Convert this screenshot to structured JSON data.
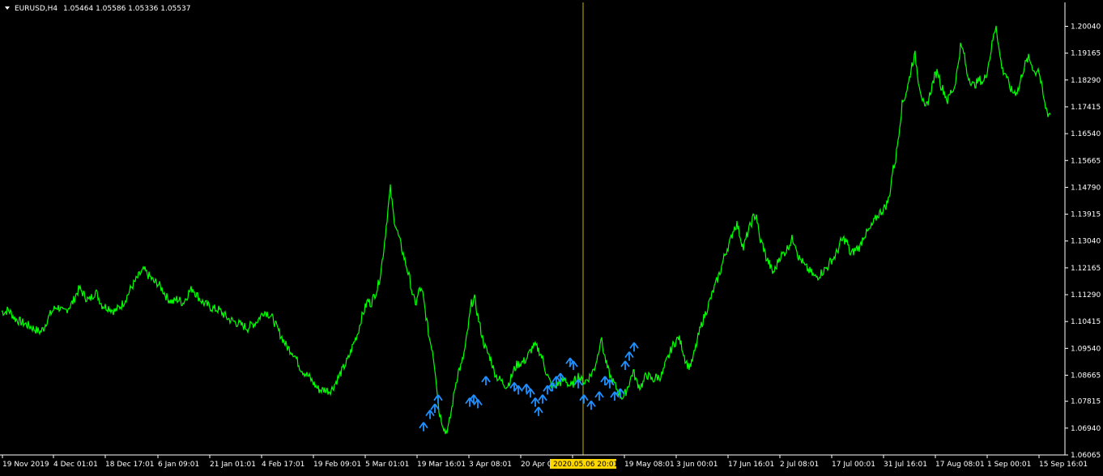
{
  "header": {
    "symbol_timeframe": "EURUSD,H4",
    "ohlc": "1.05464 1.05586 1.05336 1.05537"
  },
  "cursor": {
    "time_label": "2020.05.06 20:01"
  },
  "colors": {
    "background": "#000000",
    "price_line": "#00ff00",
    "arrows": "#1e90ff",
    "axis": "#ffffff",
    "crosshair": "#c8b400",
    "time_highlight": "#ffd700"
  },
  "chart_data": {
    "type": "line",
    "title": "EURUSD,H4",
    "ylim": [
      1.059,
      1.206
    ],
    "y_ticks": [
      "1.20040",
      "1.19165",
      "1.18290",
      "1.17415",
      "1.16540",
      "1.15665",
      "1.14790",
      "1.13915",
      "1.13040",
      "1.12165",
      "1.11290",
      "1.10415",
      "1.09540",
      "1.08665",
      "1.07815",
      "1.06940",
      "1.06065"
    ],
    "x_ticks": [
      "19 Nov 2019",
      "4 Dec 01:01",
      "18 Dec 17:01",
      "6 Jan 09:01",
      "21 Jan 01:01",
      "4 Feb 17:01",
      "19 Feb 09:01",
      "5 Mar 01:01",
      "19 Mar 16:01",
      "3 Apr 08:01",
      "20 Apr 00:01",
      "",
      "19 May 08:01",
      "3 Jun 00:01",
      "17 Jun 16:01",
      "2 Jul 08:01",
      "17 Jul 00:01",
      "31 Jul 16:01",
      "17 Aug 08:01",
      "1 Sep 00:01",
      "15 Sep 16:01"
    ],
    "series": [
      {
        "x_index": [
          0,
          4,
          8,
          12,
          16,
          20,
          24,
          28,
          32,
          36,
          40,
          44,
          48,
          52,
          56,
          60,
          64,
          68,
          72,
          76,
          80,
          84,
          88,
          92,
          96,
          100,
          104,
          108,
          112,
          116,
          120,
          124,
          128,
          132,
          136,
          140,
          144,
          148,
          152,
          156,
          160,
          164,
          168,
          172,
          176,
          180,
          184,
          188,
          192,
          196,
          200,
          204,
          208,
          212,
          216,
          220,
          224,
          228,
          232,
          236,
          240,
          244,
          248,
          252,
          256,
          260,
          264,
          268,
          272,
          276,
          280,
          284,
          288,
          292,
          296,
          300,
          304,
          308,
          312,
          316,
          320,
          324,
          328,
          332,
          336,
          340,
          344,
          348,
          352,
          356,
          360,
          364,
          368,
          372,
          376,
          380,
          384,
          388,
          392,
          396,
          400,
          404,
          408,
          412,
          416,
          420,
          424,
          428,
          432,
          436,
          440,
          444,
          448,
          452,
          456,
          460,
          464,
          468,
          472,
          476,
          480,
          484,
          488,
          492,
          496,
          500,
          504,
          508,
          512,
          516,
          520,
          524,
          528,
          532,
          536,
          540,
          544,
          548,
          552,
          556,
          560,
          564,
          568,
          572,
          576,
          580,
          584,
          588,
          592,
          596,
          600,
          604,
          608,
          612,
          616,
          620,
          624,
          628,
          632,
          636,
          640,
          644,
          648,
          652,
          656,
          660,
          664,
          668,
          672,
          676,
          680,
          684,
          688,
          692,
          696,
          700,
          704,
          708,
          712,
          716,
          720,
          724,
          728,
          732,
          736,
          740,
          744,
          748,
          752,
          756,
          760,
          764,
          768,
          772,
          776,
          780,
          784,
          788,
          792,
          796,
          800,
          804,
          808,
          812,
          816,
          820,
          824,
          828,
          832,
          836,
          840,
          844,
          848,
          852,
          856,
          860,
          864,
          868,
          872,
          876,
          880,
          884,
          888,
          892,
          896,
          900,
          904,
          908,
          912,
          916,
          920,
          924,
          928,
          932,
          936,
          940,
          944,
          948,
          952,
          956,
          960,
          964,
          968,
          972,
          976,
          980,
          984,
          988,
          992,
          996,
          1000,
          1004,
          1008,
          1012,
          1016,
          1020,
          1024,
          1028,
          1032,
          1036,
          1040,
          1044,
          1048,
          1052,
          1056,
          1060,
          1064,
          1068,
          1072,
          1076,
          1080,
          1084,
          1088,
          1092,
          1096,
          1100,
          1104,
          1108,
          1112,
          1116,
          1120,
          1124,
          1128,
          1132,
          1136,
          1140,
          1144,
          1148,
          1152,
          1156,
          1160,
          1164,
          1168,
          1172,
          1176,
          1180,
          1184,
          1188,
          1192,
          1196,
          1200,
          1204,
          1208,
          1212,
          1216,
          1220,
          1224,
          1228,
          1232,
          1236,
          1240,
          1244,
          1248,
          1252,
          1256,
          1260,
          1264,
          1268,
          1272,
          1276,
          1280,
          1284,
          1288,
          1292,
          1296,
          1300,
          1304,
          1308,
          1312
        ],
        "values": [
          1.1075,
          1.1072,
          1.108,
          1.1068,
          1.1052,
          1.1045,
          1.104,
          1.1035,
          1.103,
          1.1025,
          1.1018,
          1.1012,
          1.1008,
          1.102,
          1.1045,
          1.1065,
          1.108,
          1.109,
          1.1085,
          1.107,
          1.108,
          1.1092,
          1.1105,
          1.113,
          1.115,
          1.1135,
          1.112,
          1.111,
          1.1125,
          1.114,
          1.1118,
          1.1095,
          1.109,
          1.1088,
          1.108,
          1.1075,
          1.1085,
          1.1095,
          1.111,
          1.113,
          1.1152,
          1.1168,
          1.1185,
          1.12,
          1.121,
          1.1195,
          1.1185,
          1.117,
          1.1168,
          1.1155,
          1.114,
          1.112,
          1.111,
          1.1105,
          1.1115,
          1.111,
          1.1102,
          1.112,
          1.114,
          1.115,
          1.1132,
          1.1118,
          1.1105,
          1.1098,
          1.1092,
          1.1085,
          1.1082,
          1.108,
          1.107,
          1.106,
          1.105,
          1.1045,
          1.104,
          1.1035,
          1.103,
          1.1025,
          1.102,
          1.103,
          1.1035,
          1.1045,
          1.106,
          1.1075,
          1.107,
          1.106,
          1.1045,
          1.102,
          1.1,
          1.098,
          1.096,
          1.095,
          1.094,
          1.092,
          1.0895,
          1.088,
          1.087,
          1.086,
          1.0845,
          1.083,
          1.082,
          1.0818,
          1.082,
          1.0815,
          1.0822,
          1.084,
          1.086,
          1.088,
          1.09,
          1.092,
          1.095,
          1.098,
          1.1005,
          1.105,
          1.108,
          1.111,
          1.11,
          1.1125,
          1.115,
          1.12,
          1.128,
          1.138,
          1.1475,
          1.1385,
          1.134,
          1.13,
          1.126,
          1.122,
          1.118,
          1.112,
          1.11,
          1.115,
          1.113,
          1.106,
          1.099,
          1.095,
          1.087,
          1.075,
          1.0715,
          1.068,
          1.07,
          1.076,
          1.083,
          1.088,
          1.09,
          1.095,
          1.102,
          1.11,
          1.1115,
          1.106,
          1.101,
          1.0965,
          1.094,
          1.092,
          1.088,
          1.086,
          1.085,
          1.084,
          1.083,
          1.085,
          1.088,
          1.09,
          1.0905,
          1.091,
          1.092,
          1.094,
          1.096,
          1.096,
          1.0945,
          1.092,
          1.088,
          1.085,
          1.083,
          1.083,
          1.084,
          1.0845,
          1.0855,
          1.0835,
          1.083,
          1.085,
          1.0865,
          1.085,
          1.0845,
          1.0855,
          1.087,
          1.089,
          1.093,
          1.099,
          1.0935,
          1.089,
          1.086,
          1.084,
          1.082,
          1.08,
          1.0795,
          1.082,
          1.085,
          1.088,
          1.0845,
          1.083,
          1.084,
          1.087,
          1.086,
          1.085,
          1.086,
          1.086,
          1.087,
          1.0905,
          1.093,
          1.096,
          1.0975,
          1.099,
          1.096,
          1.092,
          1.0895,
          1.0905,
          1.0945,
          1.099,
          1.103,
          1.106,
          1.109,
          1.112,
          1.115,
          1.118,
          1.121,
          1.125,
          1.128,
          1.1305,
          1.1345,
          1.136,
          1.132,
          1.128,
          1.132,
          1.135,
          1.138,
          1.139,
          1.131,
          1.129,
          1.125,
          1.123,
          1.12,
          1.1215,
          1.125,
          1.126,
          1.127,
          1.129,
          1.131,
          1.13,
          1.125,
          1.124,
          1.122,
          1.121,
          1.12,
          1.1185,
          1.119,
          1.12,
          1.121,
          1.122,
          1.124,
          1.125,
          1.127,
          1.13,
          1.131,
          1.13,
          1.126,
          1.127,
          1.128,
          1.1285,
          1.132,
          1.133,
          1.134,
          1.136,
          1.138,
          1.1395,
          1.1405,
          1.142,
          1.1445,
          1.153,
          1.157,
          1.166,
          1.175,
          1.178,
          1.182,
          1.188,
          1.191,
          1.183,
          1.178,
          1.173,
          1.176,
          1.18,
          1.184,
          1.186,
          1.181,
          1.179,
          1.176,
          1.179,
          1.18,
          1.186,
          1.194,
          1.192,
          1.185,
          1.183,
          1.181,
          1.182,
          1.183,
          1.182,
          1.185,
          1.19,
          1.196,
          1.2011,
          1.192,
          1.186,
          1.185,
          1.181,
          1.179,
          1.179,
          1.18,
          1.185,
          1.188,
          1.19,
          1.188,
          1.185,
          1.187,
          1.181,
          1.175,
          1.172
        ]
      },
      {
        "name": "",
        "type": "scatter",
        "marker": "up-arrow",
        "x_index": [
          523,
          531,
          537,
          541,
          580,
          585,
          590,
          600,
          635,
          640,
          650,
          655,
          661,
          665,
          670,
          676,
          682,
          687,
          692,
          704,
          708,
          714,
          721,
          730,
          740,
          747,
          753,
          759,
          766,
          772,
          777,
          783
        ],
        "values": [
          1.071,
          1.075,
          1.077,
          1.08,
          1.079,
          1.08,
          1.0785,
          1.086,
          1.084,
          1.083,
          1.0835,
          1.082,
          1.079,
          1.076,
          1.08,
          1.083,
          1.084,
          1.086,
          1.087,
          1.092,
          1.091,
          1.085,
          1.08,
          1.078,
          1.081,
          1.086,
          1.085,
          1.081,
          1.082,
          1.091,
          1.094,
          1.097
        ]
      }
    ]
  }
}
